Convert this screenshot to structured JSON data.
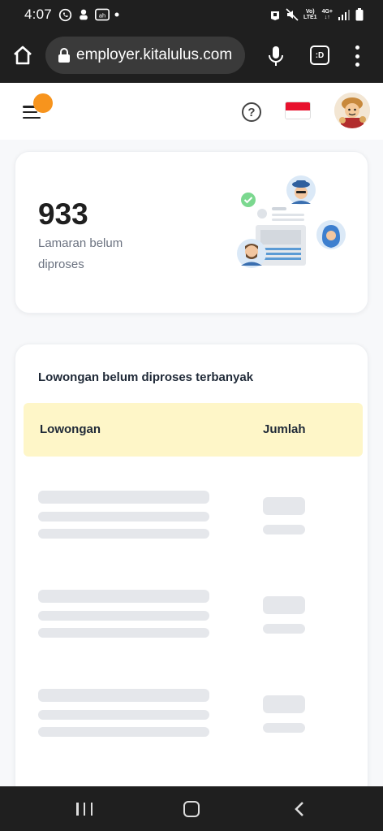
{
  "status_bar": {
    "time": "4:07",
    "network_label_1": "Vo)",
    "network_label_2": "LTE1",
    "network_label_3": "4G+",
    "icons": [
      "whatsapp-icon",
      "app-icon",
      "app-badge-icon",
      "dot-icon",
      "alarm-icon",
      "mute-icon",
      "signal-icon",
      "battery-icon"
    ]
  },
  "browser": {
    "url": "employer.kitalulus.com",
    "tab_label": ":D"
  },
  "header": {
    "help_symbol": "?",
    "colors": {
      "notif_dot": "#f7941d",
      "flag_red": "#e8112d"
    }
  },
  "stats_card": {
    "count": "933",
    "label": "Lamaran belum diproses"
  },
  "table_card": {
    "title": "Lowongan belum diproses terbanyak",
    "columns": [
      "Lowongan",
      "Jumlah"
    ],
    "header_bg": "#fef6c8"
  }
}
